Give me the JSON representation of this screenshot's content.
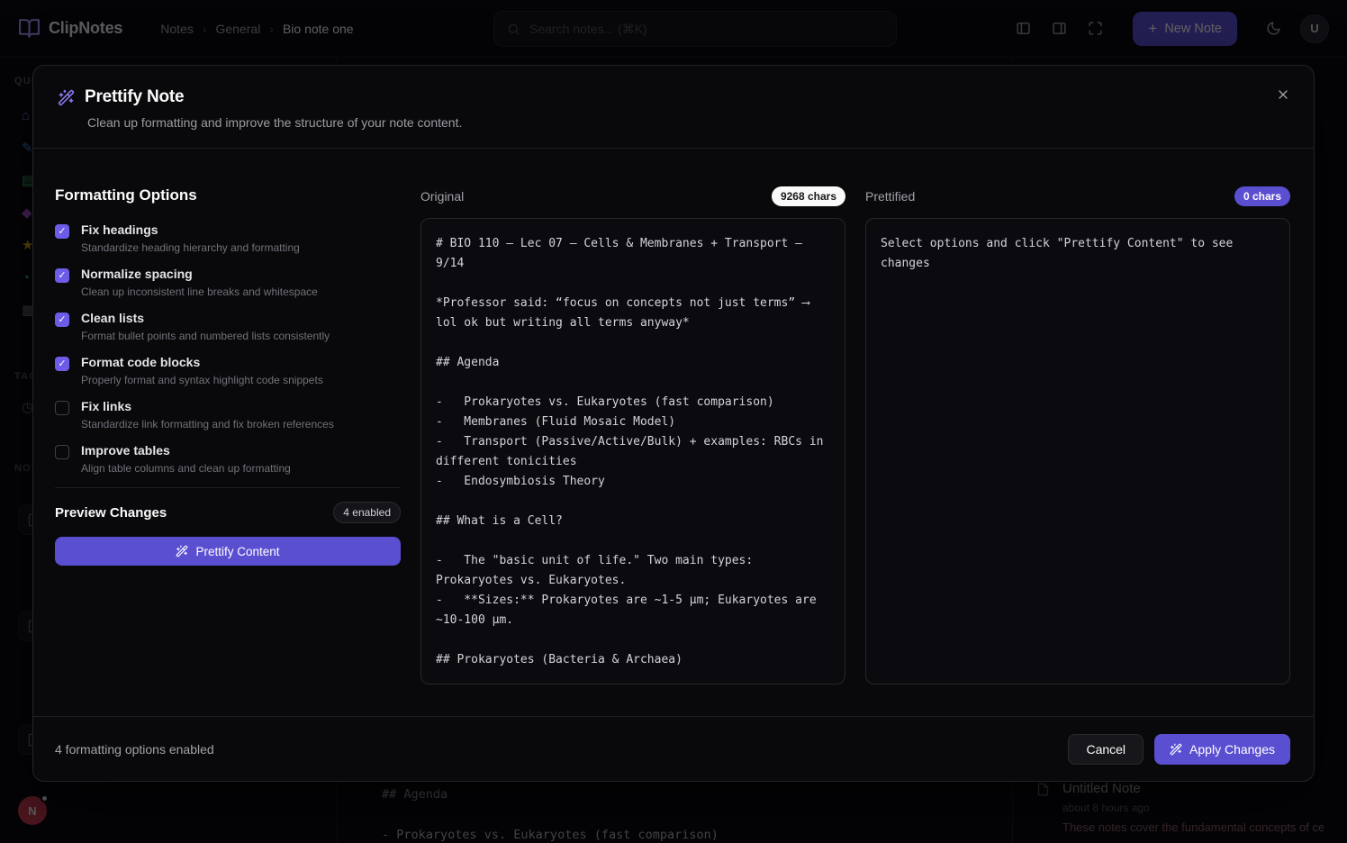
{
  "colors": {
    "accent": "#5b4fd1",
    "accent_bright": "#6c5ce7",
    "badge_light_bg": "#fafafa",
    "badge_light_text": "#18181b"
  },
  "icons": {
    "logo": "open-book",
    "search": "magnifier",
    "panel_left": "layout-sidebar-left",
    "panel_right": "layout-sidebar-right",
    "scan": "maximize-corners",
    "new_note": "plus",
    "theme": "moon",
    "wand": "magic-wand",
    "close": "x",
    "note": "file-text"
  },
  "navbar": {
    "brand": "ClipNotes",
    "crumb1": "Notes",
    "crumb2": "General",
    "crumb3": "Bio note one",
    "search_placeholder": "Search notes... (⌘K)",
    "new_note_label": "New Note",
    "user_initial": "U"
  },
  "sidebar": {
    "section_quick": "QUI",
    "section_tags": "TAG",
    "section_notes": "NOT",
    "avatar_initial": "N"
  },
  "editor_preview": {
    "line1": "## Agenda",
    "line2": "-   Prokaryotes vs. Eukaryotes (fast comparison)"
  },
  "right_panel": {
    "note_title": "Untitled Note",
    "note_time": "about 8 hours ago",
    "note_snippet": "These notes cover the fundamental concepts of cell"
  },
  "modal": {
    "title": "Prettify Note",
    "subtitle": "Clean up formatting and improve the structure of your note content.",
    "options_heading": "Formatting Options",
    "options": [
      {
        "label": "Fix headings",
        "description": "Standardize heading hierarchy and formatting",
        "checked": true
      },
      {
        "label": "Normalize spacing",
        "description": "Clean up inconsistent line breaks and whitespace",
        "checked": true
      },
      {
        "label": "Clean lists",
        "description": "Format bullet points and numbered lists consistently",
        "checked": true
      },
      {
        "label": "Format code blocks",
        "description": "Properly format and syntax highlight code snippets",
        "checked": true
      },
      {
        "label": "Fix links",
        "description": "Standardize link formatting and fix broken references",
        "checked": false
      },
      {
        "label": "Improve tables",
        "description": "Align table columns and clean up formatting",
        "checked": false
      }
    ],
    "preview_heading": "Preview Changes",
    "enabled_badge": "4 enabled",
    "prettify_button": "Prettify Content",
    "original": {
      "label": "Original",
      "chars_badge": "9268 chars",
      "content": "# BIO 110 — Lec 07 — Cells & Membranes + Transport — 9/14\n\n*Professor said: “focus on concepts not just terms” ⟶ lol ok but writing all terms anyway*\n\n## Agenda\n\n-   Prokaryotes vs. Eukaryotes (fast comparison)\n-   Membranes (Fluid Mosaic Model)\n-   Transport (Passive/Active/Bulk) + examples: RBCs in different tonicities\n-   Endosymbiosis Theory\n\n## What is a Cell?\n\n-   The \"basic unit of life.\" Two main types: Prokaryotes vs. Eukaryotes.\n-   **Sizes:** Prokaryotes are ~1-5 μm; Eukaryotes are ~10-100 μm.\n\n## Prokaryotes (Bacteria & Archaea)"
    },
    "prettified": {
      "label": "Prettified",
      "chars_badge": "0 chars",
      "placeholder": "Select options and click \"Prettify Content\" to see changes"
    },
    "footer": {
      "status": "4 formatting options enabled",
      "cancel_label": "Cancel",
      "apply_label": "Apply Changes"
    }
  }
}
